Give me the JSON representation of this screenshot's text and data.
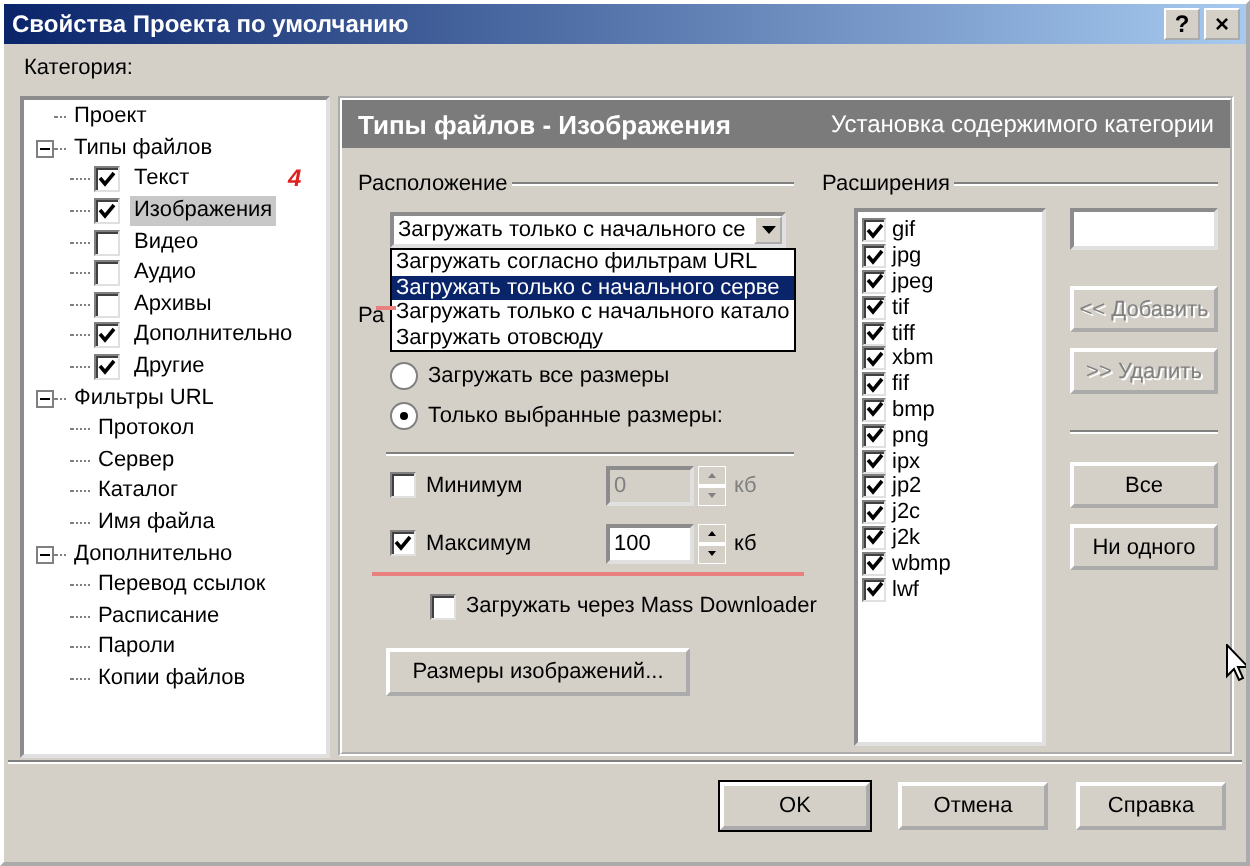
{
  "window": {
    "title": "Свойства Проекта по умолчанию",
    "buttons": [
      "?",
      "×"
    ]
  },
  "category_label": "Категория:",
  "tree": [
    {
      "label": "Проект",
      "selected": false
    },
    {
      "label": "Типы файлов",
      "selected": false,
      "expanded": true,
      "children": [
        {
          "label": "Текст",
          "checked": true,
          "selected": false
        },
        {
          "label": "Изображения",
          "checked": true,
          "selected": true
        },
        {
          "label": "Видео",
          "checked": false,
          "selected": false
        },
        {
          "label": "Аудио",
          "checked": false,
          "selected": false
        },
        {
          "label": "Архивы",
          "checked": false,
          "selected": false
        },
        {
          "label": "Дополнительно",
          "checked": true,
          "selected": false
        },
        {
          "label": "Другие",
          "checked": true,
          "selected": false
        }
      ]
    },
    {
      "label": "Фильтры URL",
      "selected": false,
      "expanded": true,
      "children": [
        {
          "label": "Протокол",
          "selected": false
        },
        {
          "label": "Сервер",
          "selected": false
        },
        {
          "label": "Каталог",
          "selected": false
        },
        {
          "label": "Имя файла",
          "selected": false
        }
      ]
    },
    {
      "label": "Дополнительно",
      "selected": false,
      "expanded": true,
      "children": [
        {
          "label": "Перевод ссылок",
          "selected": false
        },
        {
          "label": "Расписание",
          "selected": false
        },
        {
          "label": "Пароли",
          "selected": false
        },
        {
          "label": "Копии файлов",
          "selected": false
        }
      ]
    }
  ],
  "annotation": "4",
  "panel": {
    "title": "Типы файлов - Изображения",
    "subtitle": "Установка содержимого категории"
  },
  "location": {
    "label": "Расположение",
    "combo_value": "Загружать только с начального се",
    "dropdown_open": true,
    "options": [
      {
        "label": "Загружать согласно фильтрам URL",
        "selected": false
      },
      {
        "label": "Загружать только с начального серве",
        "selected": true
      },
      {
        "label": "Загружать только с начального катало",
        "selected": false
      },
      {
        "label": "Загружать отовсюду",
        "selected": false
      }
    ]
  },
  "size": {
    "label": "Ра",
    "radios": [
      {
        "label": "Загружать все размеры",
        "selected": false
      },
      {
        "label": "Только выбранные размеры:",
        "selected": true
      }
    ],
    "limits": [
      {
        "label": "Минимум",
        "checked": false,
        "value": "0",
        "unit": "кб",
        "disabled": true
      },
      {
        "label": "Максимум",
        "checked": true,
        "value": "100",
        "unit": "кб",
        "disabled": false
      }
    ],
    "mass_downloader": {
      "label": "Загружать через Mass Downloader",
      "checked": false
    },
    "sizes_button": "Размеры изображений..."
  },
  "extensions": {
    "label": "Расширения",
    "items": [
      {
        "label": "gif",
        "checked": true
      },
      {
        "label": "jpg",
        "checked": true
      },
      {
        "label": "jpeg",
        "checked": true
      },
      {
        "label": "tif",
        "checked": true
      },
      {
        "label": "tiff",
        "checked": true
      },
      {
        "label": "xbm",
        "checked": true
      },
      {
        "label": "fif",
        "checked": true
      },
      {
        "label": "bmp",
        "checked": true
      },
      {
        "label": "png",
        "checked": true
      },
      {
        "label": "ipx",
        "checked": true
      },
      {
        "label": "jp2",
        "checked": true
      },
      {
        "label": "j2c",
        "checked": true
      },
      {
        "label": "j2k",
        "checked": true
      },
      {
        "label": "wbmp",
        "checked": true
      },
      {
        "label": "lwf",
        "checked": true
      }
    ],
    "add_button": {
      "label": "<< Добавить",
      "disabled": true
    },
    "remove_button": {
      "label": ">> Удалить",
      "disabled": true
    },
    "all_button": "Все",
    "none_button": "Ни одного"
  },
  "buttons": [
    "OK",
    "Отмена",
    "Справка"
  ]
}
